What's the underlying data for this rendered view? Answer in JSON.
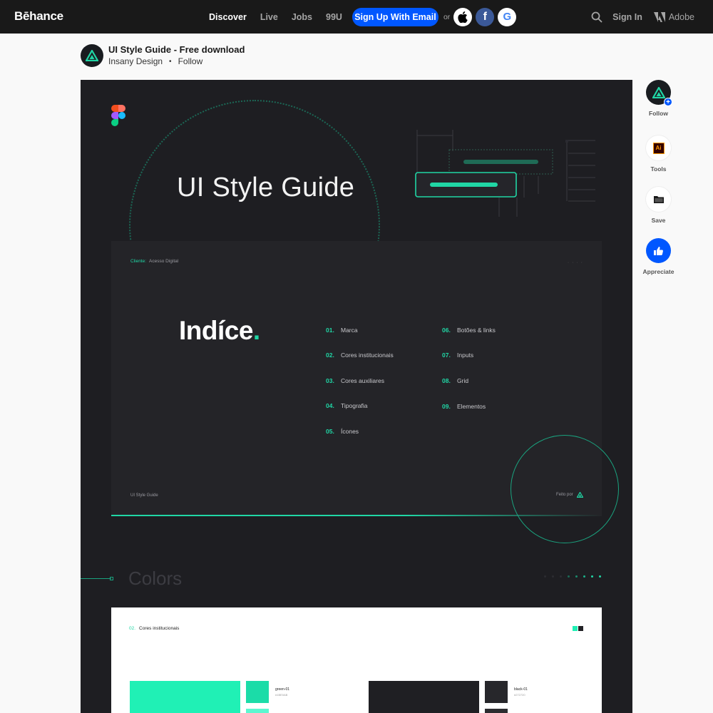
{
  "nav": {
    "logo": "Bēhance",
    "links": [
      "Discover",
      "Live",
      "Jobs",
      "99U"
    ],
    "signup_label": "Sign Up With Email",
    "or_text": "or",
    "facebook_glyph": "f",
    "google_glyph": "G",
    "signin_label": "Sign In",
    "adobe_label": "Adobe"
  },
  "project": {
    "title": "UI Style Guide - Free download",
    "owner": "Insany Design",
    "follow_label": "Follow"
  },
  "canvas": {
    "hero_title": "UI Style Guide",
    "client_key": "Cliente:",
    "client_value": "Acesso Digital",
    "card_dots": "· · · ·",
    "indice_text": "Indíce",
    "indice_accent": ".",
    "toc": [
      {
        "num": "01.",
        "label": "Marca"
      },
      {
        "num": "02.",
        "label": "Cores institucionais"
      },
      {
        "num": "03.",
        "label": "Cores auxiliares"
      },
      {
        "num": "04.",
        "label": "Tipografia"
      },
      {
        "num": "05.",
        "label": "Ícones"
      },
      {
        "num": "06.",
        "label": "Botões & links"
      },
      {
        "num": "07.",
        "label": "Inputs"
      },
      {
        "num": "08.",
        "label": "Grid"
      },
      {
        "num": "09.",
        "label": "Elementos"
      }
    ],
    "footer_left": "UI Style Guide",
    "footer_right": "Feito por",
    "colors_heading": "Colors",
    "colors_card": {
      "num": "02.",
      "title": "Cores institucionais",
      "swatches": [
        {
          "name": "green-01",
          "hex": "#1BE0AB"
        },
        {
          "name": "black-01",
          "hex": "#272720"
        }
      ]
    }
  },
  "sidebar": {
    "follow_label": "Follow",
    "tools_label": "Tools",
    "tools_glyph": "Ai",
    "save_label": "Save",
    "appreciate_label": "Appreciate"
  },
  "colors": {
    "nav_bg": "#191919",
    "brand_blue": "#0057ff",
    "accent_green": "#20d6a5",
    "canvas_bg": "#1e1e22"
  }
}
